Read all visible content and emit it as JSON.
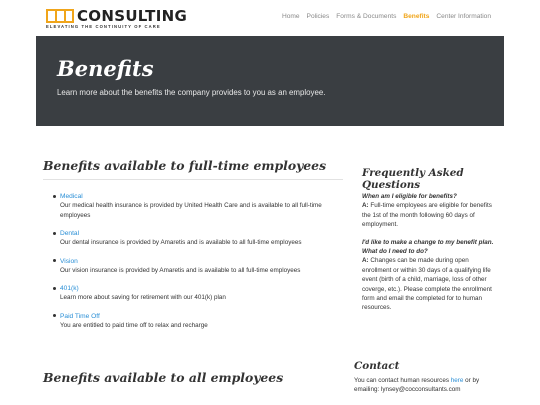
{
  "brand": {
    "name": "CONSULTING",
    "tagline": "ELEVATING THE CONTINUITY OF CARE"
  },
  "nav": [
    {
      "label": "Home",
      "active": false
    },
    {
      "label": "Policies",
      "active": false
    },
    {
      "label": "Forms & Documents",
      "active": false
    },
    {
      "label": "Benefits",
      "active": true
    },
    {
      "label": "Center Information",
      "active": false
    }
  ],
  "hero": {
    "title": "Benefits",
    "subtitle": "Learn more about the benefits the company provides to you as an employee."
  },
  "fulltime": {
    "title": "Benefits available to full-time employees",
    "items": [
      {
        "label": "Medical",
        "desc": "Our medical health insurance is provided by United Health Care and is available to all full-time employees"
      },
      {
        "label": "Dental",
        "desc": "Our dental insurance is provided by Amaretis and is available to all full-time employees"
      },
      {
        "label": "Vision",
        "desc": "Our vision insurance is provided by Amaretis and is available to all full-time employees"
      },
      {
        "label": "401(k)",
        "desc": "Learn more about saving for retirement with our 401(k) plan"
      },
      {
        "label": "Paid Time Off",
        "desc": "You are entitled to paid time off to relax and recharge"
      }
    ]
  },
  "all": {
    "title": "Benefits available to all employees"
  },
  "faq": {
    "title": "Frequently Asked Questions",
    "items": [
      {
        "q": "When am I eligible for benefits?",
        "a_prefix": "A:",
        "a": "Full-time employees are eligible for benefits the 1st of the month following 60 days of employment."
      },
      {
        "q": "I'd like to make a change to my benefit plan. What do I need to do?",
        "a_prefix": "A:",
        "a": "Changes can be made during open enrollment or within 30 days of a qualifying life event (birth of a child, marriage, loss of other coverge, etc.). Please complete the enrollment form and email the completed for to human resources."
      }
    ]
  },
  "contact": {
    "title": "Contact",
    "text_before": "You can contact human resources",
    "link": "here",
    "text_after": "or by emailing: lynsey@cocconsultants.com"
  },
  "colors": {
    "accent": "#f0a51a",
    "link": "#2a8fd6",
    "hero_bg": "#3a3e42"
  }
}
